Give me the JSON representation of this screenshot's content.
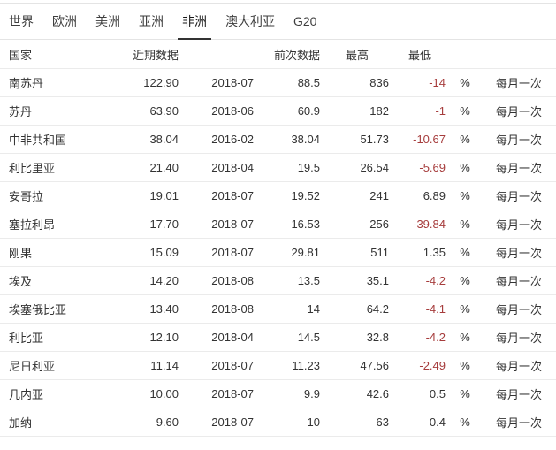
{
  "tabs": [
    {
      "label": "世界",
      "active": false
    },
    {
      "label": "欧洲",
      "active": false
    },
    {
      "label": "美洲",
      "active": false
    },
    {
      "label": "亚洲",
      "active": false
    },
    {
      "label": "非洲",
      "active": true
    },
    {
      "label": "澳大利亚",
      "active": false
    },
    {
      "label": "G20",
      "active": false
    }
  ],
  "table": {
    "headers": {
      "country": "国家",
      "recent": "近期数据",
      "previous": "前次数据",
      "highest": "最高",
      "lowest": "最低"
    },
    "unit": "%",
    "frequency": "每月一次",
    "rows": [
      {
        "country": "南苏丹",
        "recent": "122.90",
        "date": "2018-07",
        "previous": "88.5",
        "highest": "836",
        "lowest": "-14"
      },
      {
        "country": "苏丹",
        "recent": "63.90",
        "date": "2018-06",
        "previous": "60.9",
        "highest": "182",
        "lowest": "-1"
      },
      {
        "country": "中非共和国",
        "recent": "38.04",
        "date": "2016-02",
        "previous": "38.04",
        "highest": "51.73",
        "lowest": "-10.67"
      },
      {
        "country": "利比里亚",
        "recent": "21.40",
        "date": "2018-04",
        "previous": "19.5",
        "highest": "26.54",
        "lowest": "-5.69"
      },
      {
        "country": "安哥拉",
        "recent": "19.01",
        "date": "2018-07",
        "previous": "19.52",
        "highest": "241",
        "lowest": "6.89"
      },
      {
        "country": "塞拉利昂",
        "recent": "17.70",
        "date": "2018-07",
        "previous": "16.53",
        "highest": "256",
        "lowest": "-39.84"
      },
      {
        "country": "刚果",
        "recent": "15.09",
        "date": "2018-07",
        "previous": "29.81",
        "highest": "511",
        "lowest": "1.35"
      },
      {
        "country": "埃及",
        "recent": "14.20",
        "date": "2018-08",
        "previous": "13.5",
        "highest": "35.1",
        "lowest": "-4.2"
      },
      {
        "country": "埃塞俄比亚",
        "recent": "13.40",
        "date": "2018-08",
        "previous": "14",
        "highest": "64.2",
        "lowest": "-4.1"
      },
      {
        "country": "利比亚",
        "recent": "12.10",
        "date": "2018-04",
        "previous": "14.5",
        "highest": "32.8",
        "lowest": "-4.2"
      },
      {
        "country": "尼日利亚",
        "recent": "11.14",
        "date": "2018-07",
        "previous": "11.23",
        "highest": "47.56",
        "lowest": "-2.49"
      },
      {
        "country": "几内亚",
        "recent": "10.00",
        "date": "2018-07",
        "previous": "9.9",
        "highest": "42.6",
        "lowest": "0.5"
      },
      {
        "country": "加纳",
        "recent": "9.60",
        "date": "2018-07",
        "previous": "10",
        "highest": "63",
        "lowest": "0.4"
      }
    ]
  },
  "colors": {
    "negative_value": "#a63c3c",
    "active_tab_underline": "#333333",
    "row_separator": "#ebebeb"
  }
}
